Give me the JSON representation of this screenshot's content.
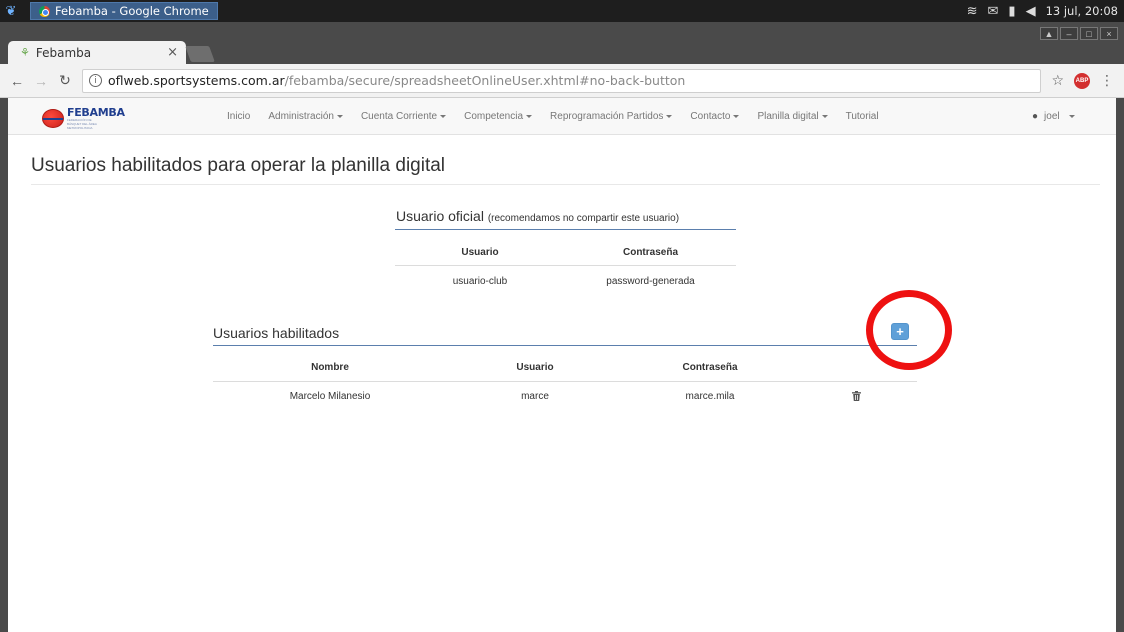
{
  "os": {
    "task_title": "Febamba - Google Chrome",
    "datetime": "13 jul, 20:08"
  },
  "browser": {
    "tab_title": "Febamba",
    "tab_close": "×",
    "url_host": "oflweb.sportsystems.com.ar",
    "url_path": "/febamba/secure/spreadsheetOnlineUser.xhtml#no-back-button",
    "abp_label": "ABP"
  },
  "site": {
    "brand": "FEBAMBA",
    "brand_sub": "FEDERACIÓN DE BÁSQUET DEL ÁREA METROPOLITANA",
    "menu": [
      {
        "label": "Inicio",
        "dropdown": false
      },
      {
        "label": "Administración",
        "dropdown": true
      },
      {
        "label": "Cuenta Corriente",
        "dropdown": true
      },
      {
        "label": "Competencia",
        "dropdown": true
      },
      {
        "label": "Reprogramación Partidos",
        "dropdown": true
      },
      {
        "label": "Contacto",
        "dropdown": true
      },
      {
        "label": "Planilla digital",
        "dropdown": true
      },
      {
        "label": "Tutorial",
        "dropdown": false
      }
    ],
    "user": "joel"
  },
  "page": {
    "title": "Usuarios habilitados para operar la planilla digital",
    "official": {
      "title": "Usuario oficial",
      "note": "(recomendamos no compartir este usuario)",
      "headers": [
        "Usuario",
        "Contraseña"
      ],
      "row": [
        "usuario-club",
        "password-generada"
      ]
    },
    "enabled": {
      "title": "Usuarios habilitados",
      "add_label": "+",
      "headers": [
        "Nombre",
        "Usuario",
        "Contraseña"
      ],
      "rows": [
        [
          "Marcelo Milanesio",
          "marce",
          "marce.mila"
        ]
      ]
    }
  }
}
